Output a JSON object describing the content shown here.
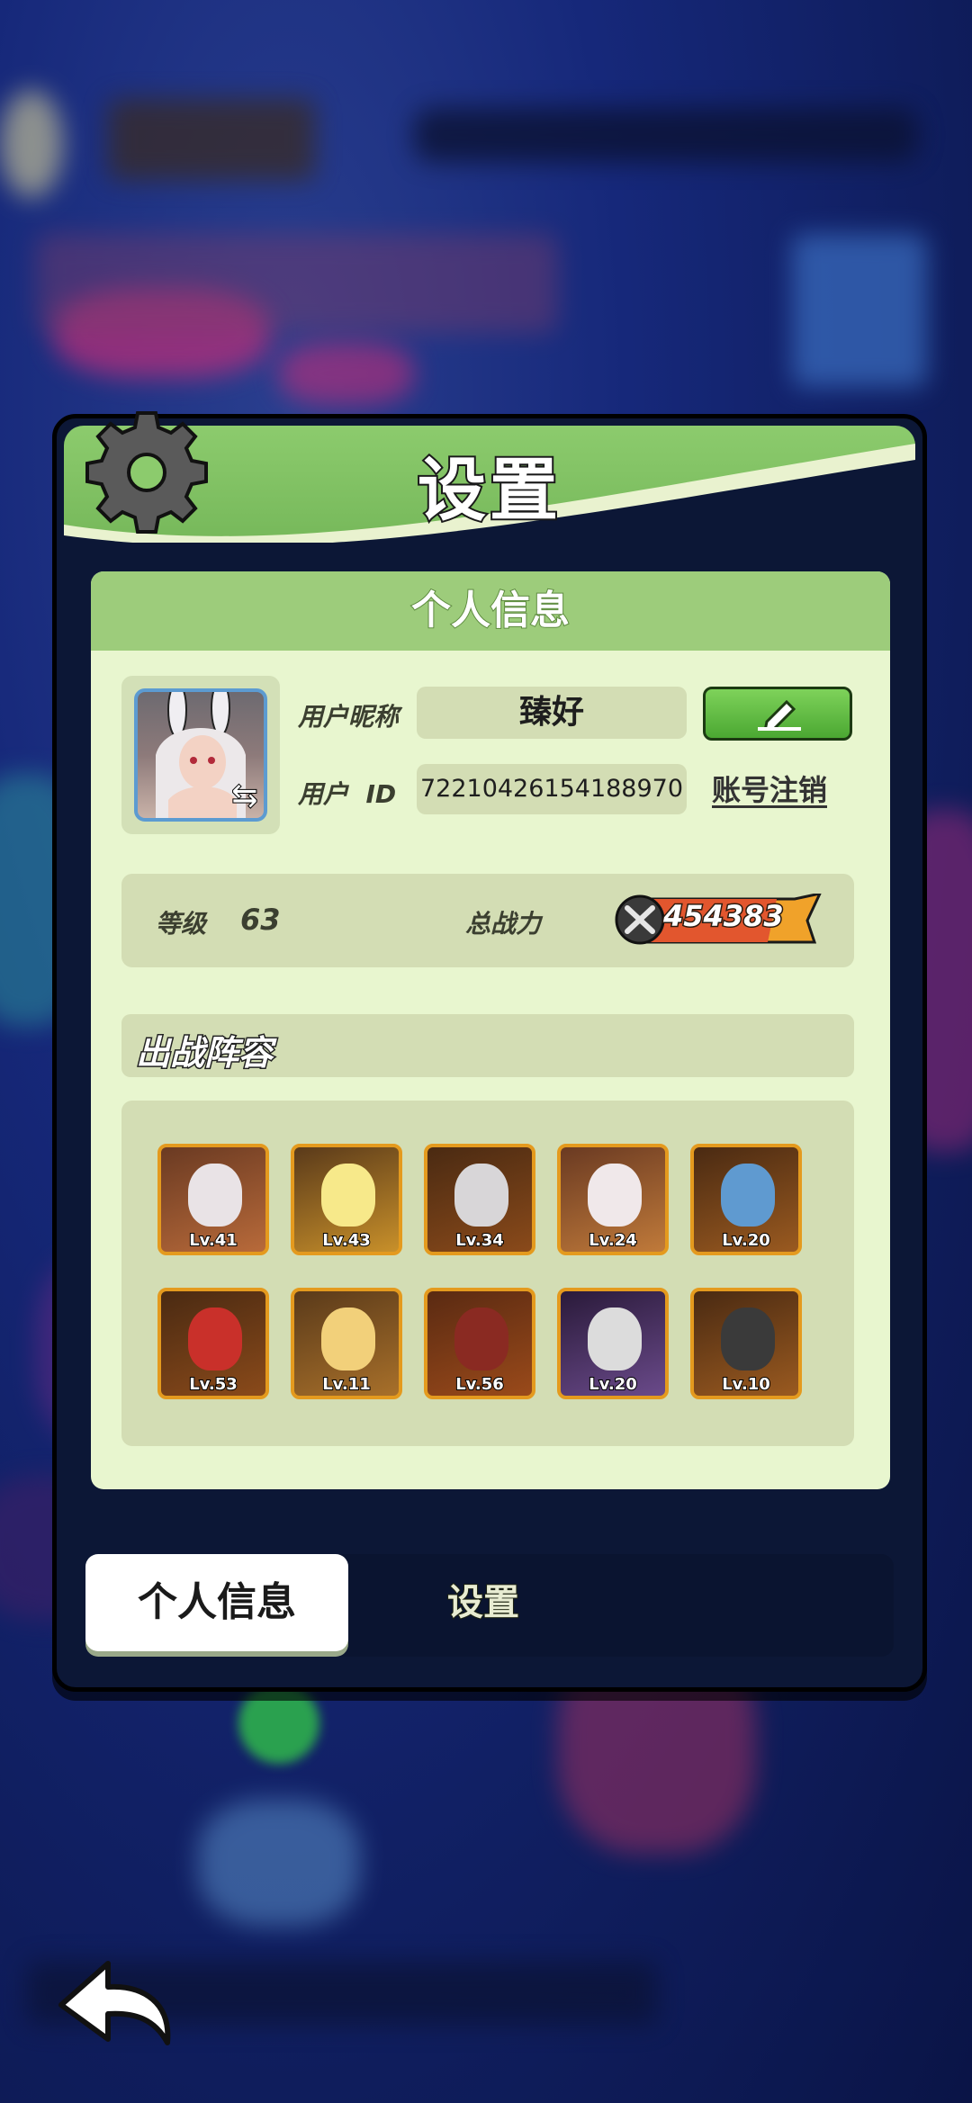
{
  "panel": {
    "title": "设置"
  },
  "personal": {
    "header": "个人信息",
    "nickname_label": "用户昵称",
    "nickname": "臻好",
    "id_label": "用户  ID",
    "user_id": "72210426154188970",
    "cancel_account": "账号注销"
  },
  "stats": {
    "level_label": "等级",
    "level": "63",
    "power_label": "总战力",
    "power": "454383"
  },
  "lineup": {
    "title": "出战阵容",
    "heroes": [
      {
        "level": "Lv.41"
      },
      {
        "level": "Lv.43"
      },
      {
        "level": "Lv.34"
      },
      {
        "level": "Lv.24"
      },
      {
        "level": "Lv.20"
      },
      {
        "level": "Lv.53"
      },
      {
        "level": "Lv.11"
      },
      {
        "level": "Lv.56"
      },
      {
        "level": "Lv.20"
      },
      {
        "level": "Lv.10"
      }
    ]
  },
  "tabs": {
    "personal": "个人信息",
    "settings": "设置"
  },
  "colors": {
    "header_green": "#8ccb6d",
    "card_bg": "#e8f6cf",
    "accent_orange": "#e49a1e"
  }
}
